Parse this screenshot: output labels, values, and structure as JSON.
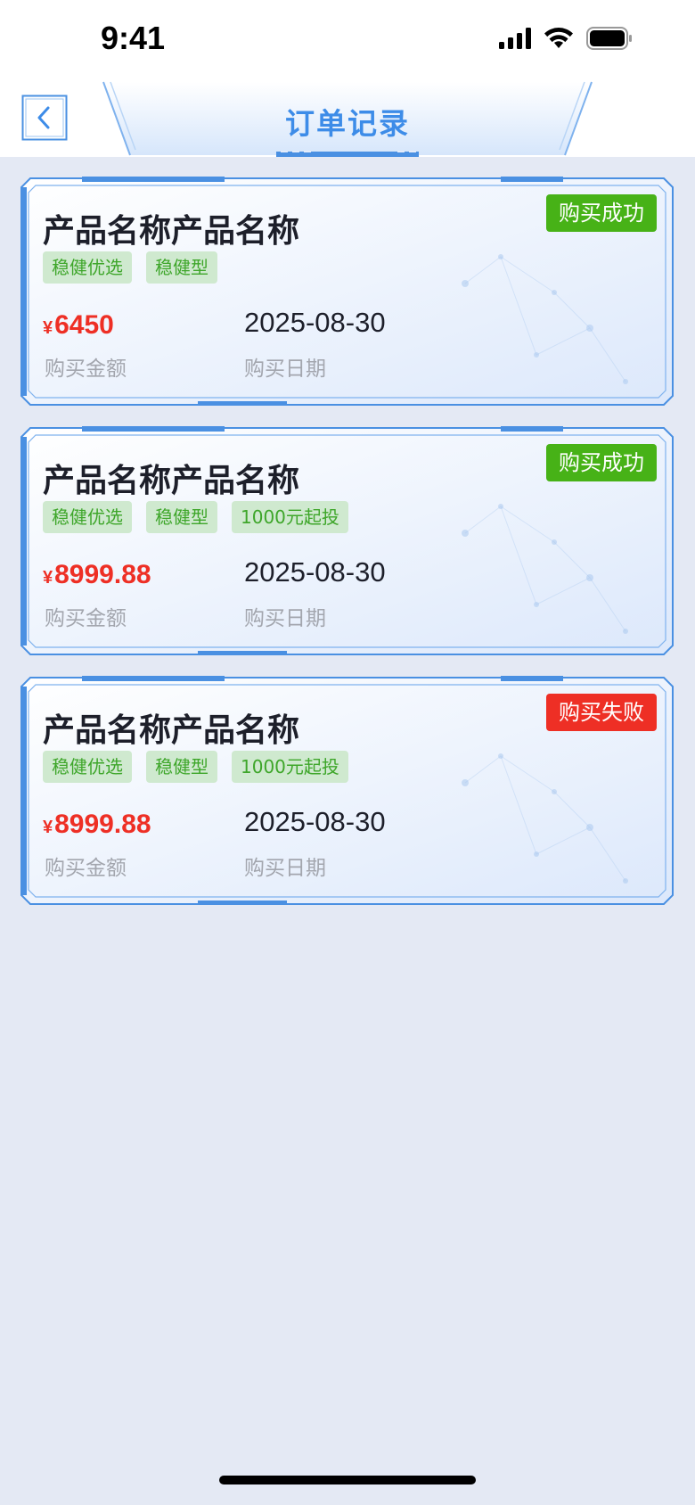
{
  "status_bar": {
    "time": "9:41"
  },
  "header": {
    "title": "订单记录",
    "back_icon": "chevron-left-icon"
  },
  "colors": {
    "accent": "#3d8ce8",
    "success": "#47b217",
    "fail": "#ee2f25",
    "amount": "#ee2f25",
    "tag_bg": "#cfe9cf",
    "tag_text": "#3ea62a",
    "page_bg": "#e4e9f4"
  },
  "orders": [
    {
      "product_name": "产品名称产品名称",
      "status": "购买成功",
      "status_type": "success",
      "tags": [
        "稳健优选",
        "稳健型"
      ],
      "currency": "¥",
      "amount": "6450",
      "amount_label": "购买金额",
      "date": "2025-08-30",
      "date_label": "购买日期"
    },
    {
      "product_name": "产品名称产品名称",
      "status": "购买成功",
      "status_type": "success",
      "tags": [
        "稳健优选",
        "稳健型",
        "1000元起投"
      ],
      "currency": "¥",
      "amount": "8999.88",
      "amount_label": "购买金额",
      "date": "2025-08-30",
      "date_label": "购买日期"
    },
    {
      "product_name": "产品名称产品名称",
      "status": "购买失败",
      "status_type": "fail",
      "tags": [
        "稳健优选",
        "稳健型",
        "1000元起投"
      ],
      "currency": "¥",
      "amount": "8999.88",
      "amount_label": "购买金额",
      "date": "2025-08-30",
      "date_label": "购买日期"
    }
  ]
}
